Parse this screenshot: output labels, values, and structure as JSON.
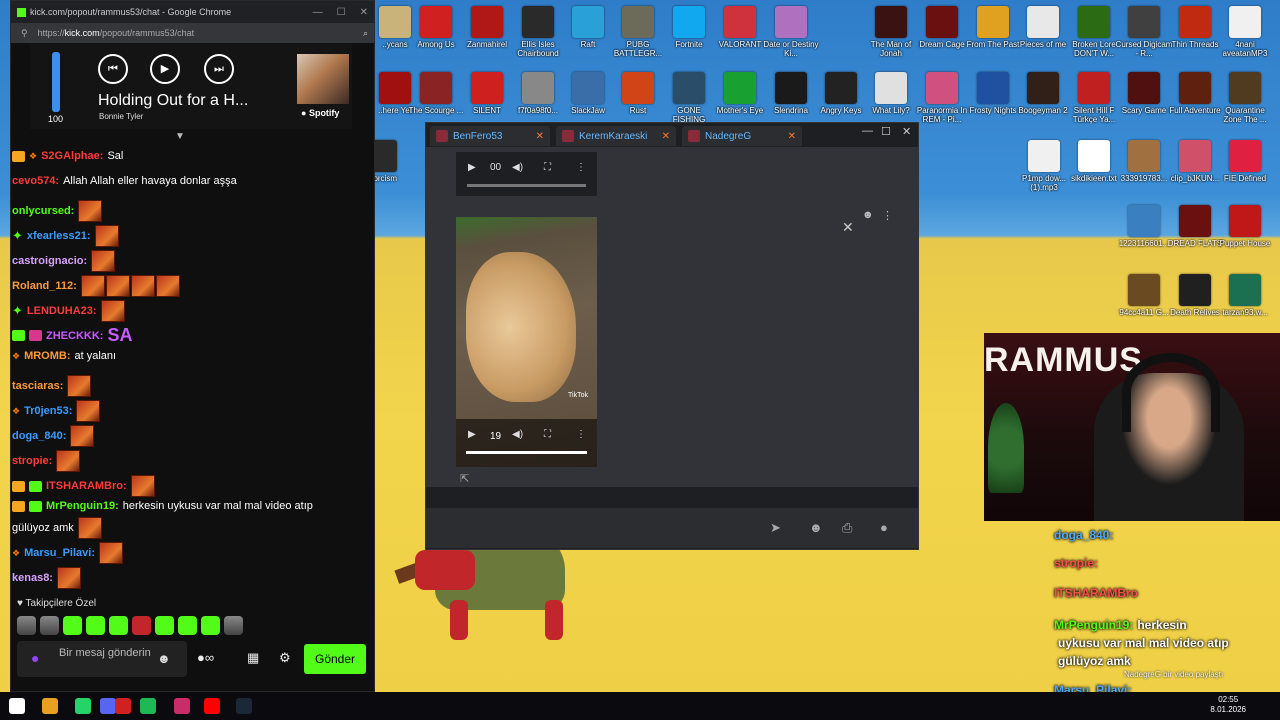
{
  "desktop": {
    "icons": [
      {
        "label": "..ycans",
        "color": "#c9b37a"
      },
      {
        "label": "Among Us",
        "color": "#d02020"
      },
      {
        "label": "Zanmahirel",
        "color": "#b01818"
      },
      {
        "label": "Ellis Isles Chairbound",
        "color": "#2a2a2a"
      },
      {
        "label": "Raft",
        "color": "#2aa0d8"
      },
      {
        "label": "PUBG BATTLEGR...",
        "color": "#6c6a58"
      },
      {
        "label": "Fortnite",
        "color": "#12a8f0"
      },
      {
        "label": "VALORANT",
        "color": "#d0323d"
      },
      {
        "label": "Date or Destiny Ki...",
        "color": "#b070c0"
      },
      {
        "label": "The Man of Jonah",
        "color": "#3a1212"
      },
      {
        "label": "Dream Cage",
        "color": "#6a1010"
      },
      {
        "label": "From The Past",
        "color": "#e0a020"
      },
      {
        "label": "Pieces of me",
        "color": "#e8e8e8"
      },
      {
        "label": "Broken Lore DON'T W...",
        "color": "#2b6b14"
      },
      {
        "label": "Cursed Digicam - R...",
        "color": "#404040"
      },
      {
        "label": "Thin Threads",
        "color": "#c02a10"
      },
      {
        "label": "4nani aveatanMP3",
        "color": "#f0f0f0"
      },
      {
        "label": "..here Yet",
        "color": "#a01010"
      },
      {
        "label": "The Scourge ...",
        "color": "#8a2424"
      },
      {
        "label": "SILENT",
        "color": "#cf2020"
      },
      {
        "label": "f7f0a98f0...",
        "color": "#888888"
      },
      {
        "label": "SlackJaw",
        "color": "#3a6ea8"
      },
      {
        "label": "Rust",
        "color": "#d04418"
      },
      {
        "label": "GONE FISHING",
        "color": "#2a4d6a"
      },
      {
        "label": "Mother's Eye",
        "color": "#18a030"
      },
      {
        "label": "Slendrina",
        "color": "#1a1a1a"
      },
      {
        "label": "Angry Keys",
        "color": "#222222"
      },
      {
        "label": "What Lily?",
        "color": "#e0e0e0"
      },
      {
        "label": "Paranormia In REM - Pi...",
        "color": "#d05080"
      },
      {
        "label": "Frosty Nights",
        "color": "#2050a0"
      },
      {
        "label": "Boogeyman 2",
        "color": "#302018"
      },
      {
        "label": "Silent Hill F Türkçe Ya...",
        "color": "#c02020"
      },
      {
        "label": "Scary Game",
        "color": "#501010"
      },
      {
        "label": "Full Adventure",
        "color": "#602010"
      },
      {
        "label": "Quarantine Zone The ...",
        "color": "#503a20"
      },
      {
        "label": "..xorcism",
        "color": "#2a2a2a"
      },
      {
        "label": "P1mp dow... (1).mp3",
        "color": "#f0f0f0"
      },
      {
        "label": "sikdikieen.txt",
        "color": "#ffffff"
      },
      {
        "label": "333919783...",
        "color": "#a07040"
      },
      {
        "label": "clip_bJKUN...",
        "color": "#d0506a"
      },
      {
        "label": "FIE Defined",
        "color": "#e02040"
      },
      {
        "label": "1223116601...",
        "color": "#3a80c0"
      },
      {
        "label": "DREAD FLATS",
        "color": "#6a1010"
      },
      {
        "label": "Puppet House",
        "color": "#c01818"
      },
      {
        "label": "94cc4a11 G...",
        "color": "#6a4a20"
      },
      {
        "label": "Death Relives",
        "color": "#202020"
      },
      {
        "label": "tarzan93.w...",
        "color": "#1a7050"
      }
    ]
  },
  "chat_window": {
    "browser_title": "kick.com/popout/rammus53/chat - Google Chrome",
    "url_prefix": "https://",
    "url_domain": "kick.com",
    "url_path": "/popout/rammus53/chat",
    "spotify": {
      "volume": 100,
      "track_title": "Holding Out for a H...",
      "artist": "Bonnie Tyler",
      "brand": "Spotify"
    },
    "messages": [
      {
        "user": "S2GAlphae:",
        "user_color": "#ff3b3b",
        "text": "Sal",
        "badges": "crown-fire",
        "emotes": 0
      },
      {
        "user": "cevo574:",
        "user_color": "#ff3b3b",
        "text": "Allah Allah eller havaya donlar aşşa",
        "badges": "",
        "emotes": 0
      },
      {
        "user": "onlycursed:",
        "user_color": "#53fc18",
        "text": "",
        "badges": "",
        "emotes": 1
      },
      {
        "user": "xfearless21:",
        "user_color": "#3b9cff",
        "text": "",
        "badges": "star",
        "emotes": 1
      },
      {
        "user": "castroignacio:",
        "user_color": "#d8a2ff",
        "text": "",
        "badges": "",
        "emotes": 1
      },
      {
        "user": "Roland_112:",
        "user_color": "#ff9a3b",
        "text": "",
        "badges": "",
        "emotes": 4
      },
      {
        "user": "LENDUHA23:",
        "user_color": "#ff3b3b",
        "text": "",
        "badges": "star",
        "emotes": 1
      },
      {
        "user": "ZHECKKK:",
        "user_color": "#c85cff",
        "text": "SA",
        "badges": "multi",
        "emotes": 0
      },
      {
        "user": "MROMB:",
        "user_color": "#ff9a3b",
        "text": "at yalanı",
        "badges": "fire",
        "emotes": 0
      },
      {
        "user": "tasciaras:",
        "user_color": "#ff9a3b",
        "text": "",
        "badges": "",
        "emotes": 1
      },
      {
        "user": "Tr0jen53:",
        "user_color": "#3b9cff",
        "text": "",
        "badges": "fire",
        "emotes": 1
      },
      {
        "user": "doga_840:",
        "user_color": "#3b9cff",
        "text": "",
        "badges": "",
        "emotes": 1
      },
      {
        "user": "stropie:",
        "user_color": "#ff3b3b",
        "text": "",
        "badges": "",
        "emotes": 1
      },
      {
        "user": "ITSHARAMBro:",
        "user_color": "#ff3b3b",
        "text": "",
        "badges": "crown-mod",
        "emotes": 1
      },
      {
        "user": "MrPenguin19:",
        "user_color": "#53fc18",
        "text": "herkesin uykusu var mal mal video atıp",
        "badges": "crown-mod",
        "emotes": 0
      },
      {
        "user": "",
        "user_color": "#ffffff",
        "text": "gülüyoz amk",
        "badges": "",
        "emotes": 1
      },
      {
        "user": "Marsu_Pilavi:",
        "user_color": "#3b9cff",
        "text": "",
        "badges": "fire",
        "emotes": 1
      },
      {
        "user": "kenas8:",
        "user_color": "#d8a2ff",
        "text": "",
        "badges": "",
        "emotes": 1
      }
    ],
    "followers_label": "♥ Takipçilere Özel",
    "input_placeholder": "Bir mesaj gönderin",
    "send_label": "Gönder"
  },
  "discord": {
    "tabs": [
      {
        "name": "BenFero53"
      },
      {
        "name": "KeremKaraeski"
      },
      {
        "name": "NadegreG"
      }
    ],
    "audio_time": "00",
    "video_time": "19",
    "tiktok_label": "TikTok"
  },
  "webcam": {
    "banner": "RAMMUS"
  },
  "overlay_chat": {
    "messages": [
      {
        "user": "doga_840:",
        "color": "#4aa8ff",
        "text": ""
      },
      {
        "user": "stropie:",
        "color": "#ff4b4b",
        "text": ""
      },
      {
        "user": "ITSHARAMBro",
        "color": "#ff4b4b",
        "text": ""
      },
      {
        "user": "MrPenguin19:",
        "color": "#53fc18",
        "text": "herkesin"
      },
      {
        "user": "",
        "color": "#ffffff",
        "text": "uykusu var mal mal video atıp"
      },
      {
        "user": "",
        "color": "#ffffff",
        "text": "gülüyoz amk"
      },
      {
        "user": "Marsu_Pilavi:",
        "color": "#4aa8ff",
        "text": ""
      }
    ],
    "notice": "NadegreG bir video paylaştı"
  },
  "taskbar": {
    "time": "02:55",
    "date": "8.01.2026",
    "apps": [
      {
        "name": "windows-start",
        "color": "#ffffff"
      },
      {
        "name": "search",
        "color": "#888888"
      },
      {
        "name": "task-view",
        "color": "#aaaaaa"
      },
      {
        "name": "chrome",
        "color": "#e8a020"
      },
      {
        "name": "whatsapp",
        "color": "#25d366"
      },
      {
        "name": "discord-app",
        "color": "#5865f2"
      },
      {
        "name": "vince",
        "color": "#d02020"
      },
      {
        "name": "spotify",
        "color": "#1db954"
      },
      {
        "name": "vpn",
        "color": "#c82d6a"
      },
      {
        "name": "youtube",
        "color": "#ff0000"
      },
      {
        "name": "steam",
        "color": "#1b2838"
      }
    ]
  }
}
